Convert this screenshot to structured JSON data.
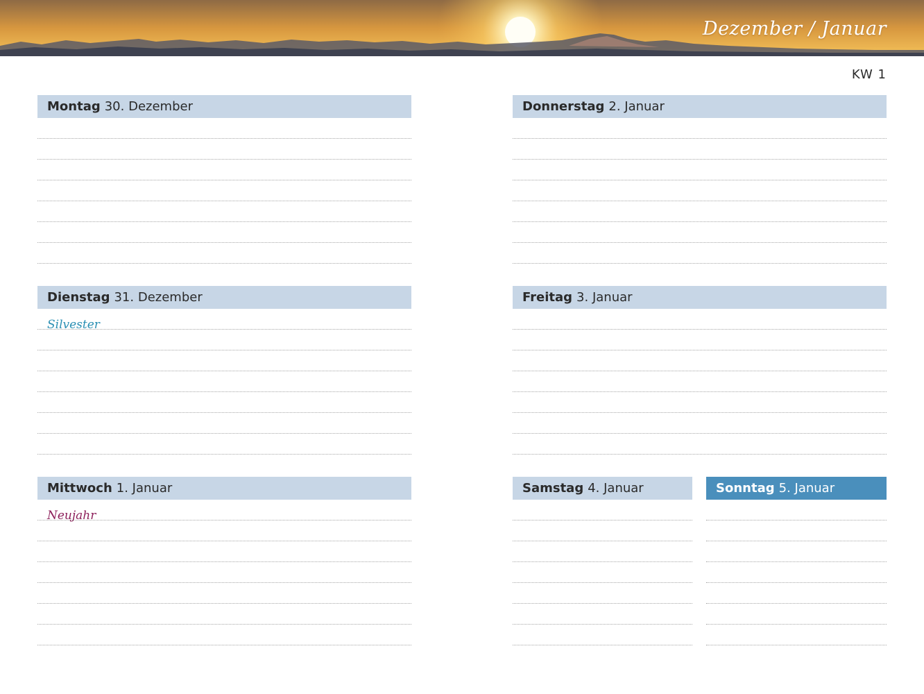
{
  "banner": {
    "title": "Dezember / Januar"
  },
  "week": "KW 1",
  "colors": {
    "header_bg": "#c7d6e6",
    "sunday_bg": "#4a8fbc",
    "silvester": "#2a8fb3",
    "neujahr": "#8c1f5a"
  },
  "days": {
    "mon": {
      "weekday": "Montag",
      "date": "30. Dezember"
    },
    "tue": {
      "weekday": "Dienstag",
      "date": "31. Dezember",
      "note": "Silvester"
    },
    "wed": {
      "weekday": "Mittwoch",
      "date": "1. Januar",
      "note": "Neujahr"
    },
    "thu": {
      "weekday": "Donnerstag",
      "date": "2. Januar"
    },
    "fri": {
      "weekday": "Freitag",
      "date": "3. Januar"
    },
    "sat": {
      "weekday": "Samstag",
      "date": "4. Januar"
    },
    "sun": {
      "weekday": "Sonntag",
      "date": "5. Januar"
    }
  }
}
